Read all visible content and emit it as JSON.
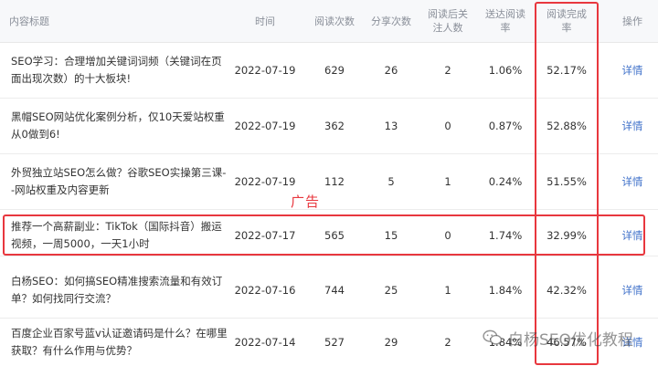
{
  "columns": {
    "title": "内容标题",
    "time": "时间",
    "reads": "阅读次数",
    "shares": "分享次数",
    "follow": "阅读后关\n注人数",
    "complete_rate": "送达阅读\n率",
    "finish_rate": "阅读完成\n率",
    "action": "操作"
  },
  "rows": [
    {
      "title": "SEO学习：合理增加关键词词频（关键词在页面出现次数）的十大板块!",
      "time": "2022-07-19",
      "reads": "629",
      "shares": "26",
      "follow": "2",
      "delivery_rate": "1.06%",
      "finish_rate": "52.17%",
      "action": "详情"
    },
    {
      "title": "黑帽SEO网站优化案例分析，仅10天爱站权重从0做到6!",
      "time": "2022-07-19",
      "reads": "362",
      "shares": "13",
      "follow": "0",
      "delivery_rate": "0.87%",
      "finish_rate": "52.88%",
      "action": "详情"
    },
    {
      "title": "外贸独立站SEO怎么做？谷歌SEO实操第三课--网站权重及内容更新",
      "time": "2022-07-19",
      "reads": "112",
      "shares": "5",
      "follow": "1",
      "delivery_rate": "0.24%",
      "finish_rate": "51.55%",
      "action": "详情"
    },
    {
      "title": "推荐一个高薪副业：TikTok（国际抖音）搬运视频，一周5000，一天1小时",
      "time": "2022-07-17",
      "reads": "565",
      "shares": "15",
      "follow": "0",
      "delivery_rate": "1.74%",
      "finish_rate": "32.99%",
      "action": "详情"
    },
    {
      "title": "白杨SEO：如何搞SEO精准搜索流量和有效订单？如何找同行交流？",
      "time": "2022-07-16",
      "reads": "744",
      "shares": "25",
      "follow": "1",
      "delivery_rate": "1.84%",
      "finish_rate": "42.32%",
      "action": "详情"
    },
    {
      "title": "百度企业百家号蓝v认证邀请码是什么？在哪里获取？有什么作用与优势？",
      "time": "2022-07-14",
      "reads": "527",
      "shares": "29",
      "follow": "2",
      "delivery_rate": "1.84%",
      "finish_rate": "46.57%",
      "action": "详情"
    }
  ],
  "annotation": {
    "ad_label": "广告"
  },
  "watermark": {
    "text": "白杨SEO优化教程"
  },
  "colors": {
    "highlight": "#e8373e",
    "link": "#3d6fc9",
    "header_bg": "#f7f8fa"
  }
}
